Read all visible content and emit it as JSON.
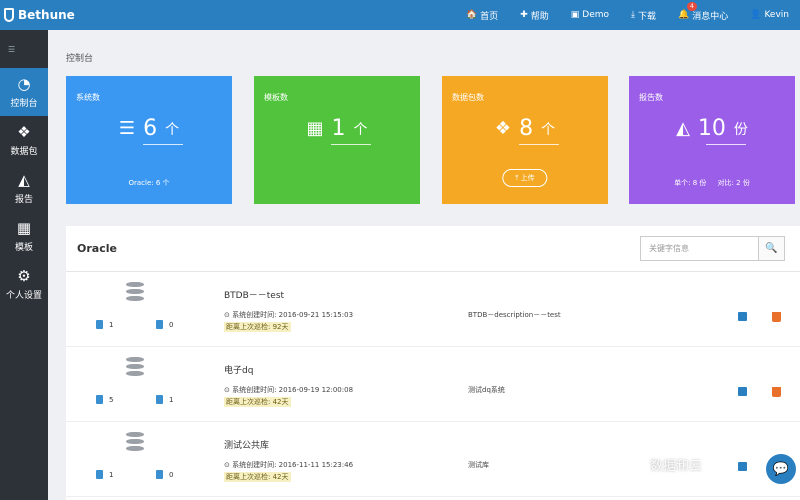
{
  "app": {
    "brand": "Bethune"
  },
  "nav": [
    {
      "name": "nav-home",
      "icon": "🏠",
      "icon_name": "home-icon",
      "label": "首页"
    },
    {
      "name": "nav-help",
      "icon": "✚",
      "icon_name": "help-icon",
      "label": "帮助"
    },
    {
      "name": "nav-demo",
      "icon": "▣",
      "icon_name": "demo-icon",
      "label": "Demo"
    },
    {
      "name": "nav-download",
      "icon": "⤓",
      "icon_name": "download-icon",
      "label": "下载"
    },
    {
      "name": "nav-messages",
      "icon": "🔔",
      "icon_name": "bell-icon",
      "label": "消息中心",
      "badge": "4"
    },
    {
      "name": "nav-user",
      "icon": "👤",
      "icon_name": "user-icon",
      "label": "Kevin"
    }
  ],
  "sidebar": {
    "toggle_icon": "☰",
    "items": [
      {
        "name": "sidebar-item-console",
        "icon": "◔",
        "icon_name": "dashboard-icon",
        "label": "控制台",
        "active": true
      },
      {
        "name": "sidebar-item-datapack",
        "icon": "❖",
        "icon_name": "cubes-icon",
        "label": "数据包",
        "active": false
      },
      {
        "name": "sidebar-item-report",
        "icon": "◭",
        "icon_name": "area-chart-icon",
        "label": "报告",
        "active": false
      },
      {
        "name": "sidebar-item-template",
        "icon": "▦",
        "icon_name": "table-icon",
        "label": "模板",
        "active": false
      },
      {
        "name": "sidebar-item-settings",
        "icon": "⚙",
        "icon_name": "gear-icon",
        "label": "个人设置",
        "active": false
      }
    ]
  },
  "page_title": "控制台",
  "cards": [
    {
      "name": "card-systems",
      "color": "#3b98f2",
      "title": "系统数",
      "icon": "☰",
      "icon_name": "database-icon",
      "value": "6",
      "unit": "个",
      "footer": "Oracle: 6 个",
      "button": ""
    },
    {
      "name": "card-templates",
      "color": "#52c33d",
      "title": "模板数",
      "icon": "▦",
      "icon_name": "table-icon",
      "value": "1",
      "unit": "个",
      "footer": "",
      "button": ""
    },
    {
      "name": "card-datapacks",
      "color": "#f4a823",
      "title": "数据包数",
      "icon": "❖",
      "icon_name": "cubes-icon",
      "value": "8",
      "unit": "个",
      "footer": "",
      "button": "⤒ 上传"
    },
    {
      "name": "card-reports",
      "color": "#9b5ee8",
      "title": "报告数",
      "icon": "◭",
      "icon_name": "area-chart-icon",
      "value": "10",
      "unit": "份",
      "footer": "单个: 8 份     对比: 2 份",
      "button": ""
    }
  ],
  "panel": {
    "title": "Oracle",
    "search_placeholder": "关键字信息",
    "search_icon": "🔍"
  },
  "rows": [
    {
      "name": "BTDB－－test",
      "count_a": "1",
      "count_b": "0",
      "created": "⊙ 系统创建时间: 2016-09-21 15:15:03",
      "inspect": "距离上次巡检: 92天",
      "desc": "BTDB－description－－test"
    },
    {
      "name": "电子dq",
      "count_a": "5",
      "count_b": "1",
      "created": "⊙ 系统创建时间: 2016-09-19 12:00:08",
      "inspect": "距离上次巡检: 42天",
      "desc": "测试dq系统"
    },
    {
      "name": "测试公共库",
      "count_a": "1",
      "count_b": "0",
      "created": "⊙ 系统创建时间: 2016-11-11 15:23:46",
      "inspect": "距离上次巡检: 42天",
      "desc": "测试库"
    }
  ],
  "watermark": "数据和云",
  "chat_icon": "💬"
}
